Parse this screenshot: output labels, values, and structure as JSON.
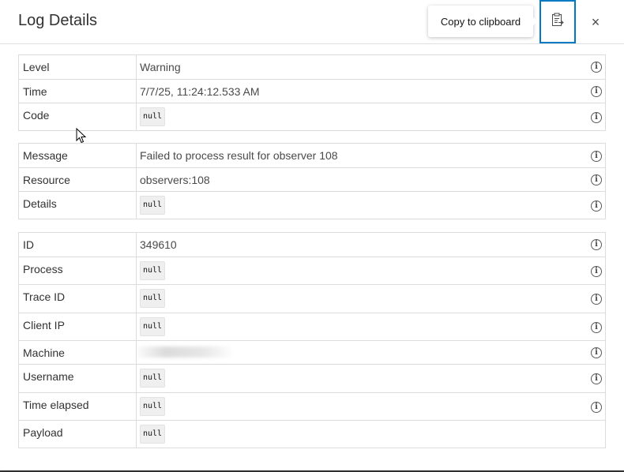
{
  "dialog": {
    "title": "Log Details",
    "tooltip": "Copy to clipboard",
    "copy_icon": "clipboard-copy-icon",
    "close_icon": "close-icon",
    "close_glyph": "×",
    "info_glyph": "i",
    "accent_color": "#007ac2"
  },
  "sections": [
    {
      "rows": [
        {
          "label": "Level",
          "value": "Warning",
          "null": false,
          "info": true
        },
        {
          "label": "Time",
          "value": "7/7/25, 11:24:12.533 AM",
          "null": false,
          "info": true
        },
        {
          "label": "Code",
          "value": "null",
          "null": true,
          "info": true
        }
      ]
    },
    {
      "rows": [
        {
          "label": "Message",
          "value": "Failed to process result for observer 108",
          "null": false,
          "info": true
        },
        {
          "label": "Resource",
          "value": "observers:108",
          "null": false,
          "info": true
        },
        {
          "label": "Details",
          "value": "null",
          "null": true,
          "info": true
        }
      ]
    },
    {
      "rows": [
        {
          "label": "ID",
          "value": "349610",
          "null": false,
          "info": true
        },
        {
          "label": "Process",
          "value": "null",
          "null": true,
          "info": true
        },
        {
          "label": "Trace ID",
          "value": "null",
          "null": true,
          "info": true
        },
        {
          "label": "Client IP",
          "value": "null",
          "null": true,
          "info": true
        },
        {
          "label": "Machine",
          "value": "",
          "null": false,
          "info": true,
          "redacted": true
        },
        {
          "label": "Username",
          "value": "null",
          "null": true,
          "info": true
        },
        {
          "label": "Time elapsed",
          "value": "null",
          "null": true,
          "info": true
        },
        {
          "label": "Payload",
          "value": "null",
          "null": true,
          "info": false
        }
      ]
    }
  ]
}
